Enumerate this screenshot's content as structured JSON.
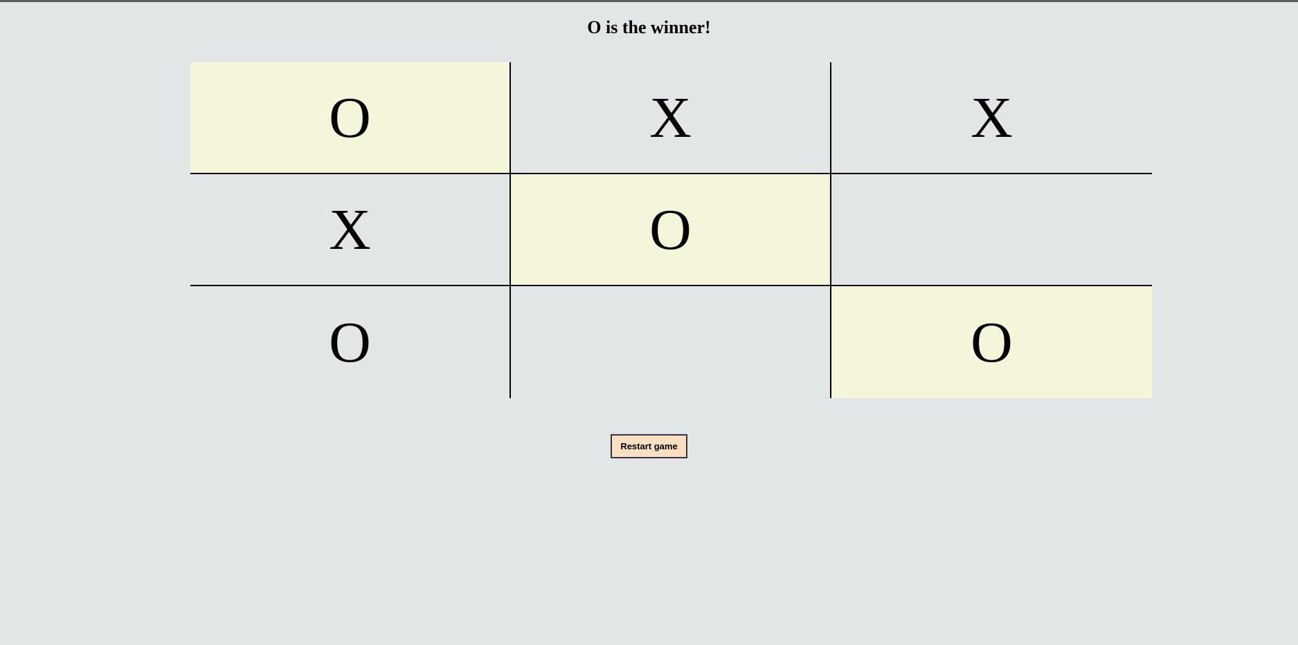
{
  "status_text": "O is the winner!",
  "board": {
    "cells": [
      {
        "value": "O",
        "highlight": true
      },
      {
        "value": "X",
        "highlight": false
      },
      {
        "value": "X",
        "highlight": false
      },
      {
        "value": "X",
        "highlight": false
      },
      {
        "value": "O",
        "highlight": true
      },
      {
        "value": "",
        "highlight": false
      },
      {
        "value": "O",
        "highlight": false
      },
      {
        "value": "",
        "highlight": false
      },
      {
        "value": "O",
        "highlight": true
      }
    ]
  },
  "controls": {
    "restart_label": "Restart game"
  },
  "colors": {
    "background": "#e2e6e7",
    "highlight": "#f5f5da",
    "button_bg": "#fcdfc0",
    "top_border": "#5a5e60"
  }
}
